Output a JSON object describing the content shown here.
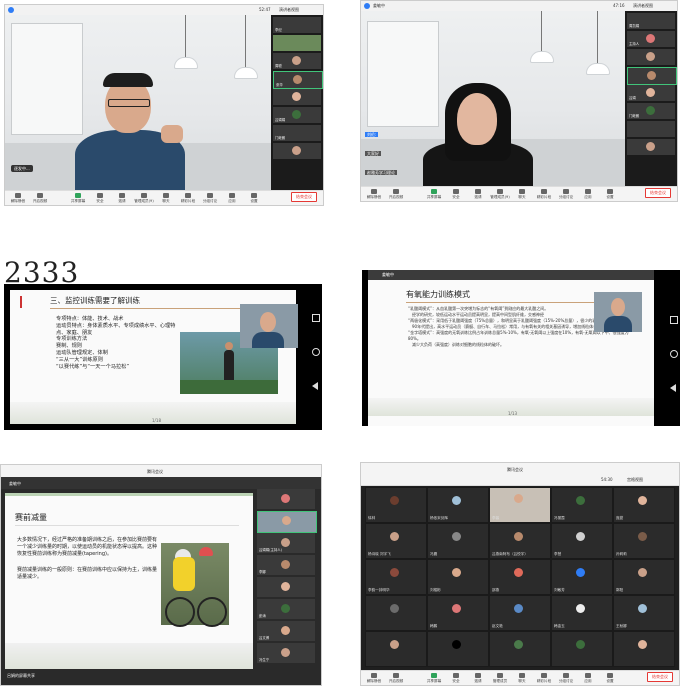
{
  "big_number": "2333",
  "panel1": {
    "time": "52:47",
    "view_button": "演讲者视图",
    "host_label": "主持人",
    "self_label": "逐发中...",
    "toolbar": [
      "解除静音",
      "开启视频",
      "共享屏幕",
      "安全",
      "邀请",
      "管理成员(9)",
      "聊天",
      "精彩片段",
      "分组讨论",
      "应用",
      "设置"
    ],
    "leave": "结束会议",
    "sidebar": [
      "李纪",
      "",
      "周聪",
      "张华",
      "",
      "吕娟娟",
      "门继朗"
    ]
  },
  "panel2": {
    "time": "47:16",
    "view_button": "演讲者视图",
    "host_label": "姜敏中",
    "toolbar": [
      "解除静音",
      "开启视频",
      "共享屏幕",
      "安全",
      "邀请",
      "管理成员(9)",
      "聊天",
      "精彩片段",
      "分组讨论",
      "应用",
      "设置"
    ],
    "leave": "结束会议",
    "sidebar": [
      "周凯娟",
      "主持人",
      "",
      "",
      "吕娟",
      "门继朗"
    ],
    "chat_lines": [
      "刘伦:",
      "大家好",
      "赵雅芳学习理论"
    ]
  },
  "panel3": {
    "title": "三、监控训练需要了解训练",
    "bullets": [
      "专项特点：体能、技术、战术",
      "运动员特点：身体素质水平、专项成绩水平、心理特点、家庭、朋友",
      "专项训练方法",
      "赛制、规则",
      "运动队管理规定、体制",
      "“三从一大”训练原则",
      "“以赛代练”与“一天一个马拉松”"
    ],
    "page": "1/18"
  },
  "panel4": {
    "host_label": "姜敏中",
    "title": "有氧能力训练模式",
    "bullets": [
      "“乳酸阈模式”：从血乳酸第一次突增为标志的“有氧阈”到刚应的最大乳酸之间。",
      "经学的研究，较低运动水平运动员提高明显，提高中间型肌纤维，交感神经",
      "“两极化模式”：采用低于乳酸阈强度（75%总量），和明显高于乳酸阈强度（15%-20%总量），很少的乳酸阈强度（5%总量）。",
      "90年代提出，高水平运动员（赛艇、自行车、马拉松）常用，与有氧有关的相关基因诱导，增加线粒体合成。",
      "“金字塔模式”：高强度的无氧训练比例占年训练总量5%-10%，有氧-无氧阈以上强度在10%，有氧-无氧阈以下中、低强度为80%。",
      "减少大负荷（高强度）训练对细胞的线粒体的破坏。"
    ],
    "page": "1/13"
  },
  "panel5": {
    "app_title": "腾讯会议",
    "host_label": "姜敏中",
    "title": "赛前减量",
    "bullets": [
      "大多数情况下，经过严格的准备期训练之后，在参加比赛前要有一个减少训练量的时期，以使运动员的机能状态得以提高。这种恢复性赛前训练称为赛前减量(tapering)。",
      "赛前减量训练的一般原则：在赛前训练中应以保持为主，训练量适量减少。"
    ],
    "footer": "吕娟的屏幕共享",
    "sidebar": [
      "",
      "",
      "吕娟娟(主持人)",
      "李娜",
      "",
      "彭涛",
      "吕文博",
      "冯生宁"
    ]
  },
  "panel6": {
    "app_title": "腾讯会议",
    "time": "54:30",
    "view_button": "宫格视图",
    "toolbar": [
      "解除静音",
      "开启视频",
      "共享屏幕",
      "安全",
      "邀请",
      "管理成员",
      "聊天",
      "精彩片段",
      "分组讨论",
      "应用",
      "设置"
    ],
    "leave": "结束会议",
    "gallery_names": [
      "徐林",
      "杨依宋剑辉",
      "李馨",
      "冯丽霞",
      "庞甜",
      "杨诗晓 刘宇飞",
      "冯震",
      "吕燕南阿布（吕悦宇）",
      "李慧",
      "孙莉莉",
      "李韵一钟明华",
      "刘榕彬",
      "邵燕",
      "刘敏芳",
      "郭阳",
      "",
      "韩鹏",
      "赵文艳",
      "韩金玉",
      "王秋娜",
      "",
      "",
      "",
      "",
      ""
    ]
  }
}
